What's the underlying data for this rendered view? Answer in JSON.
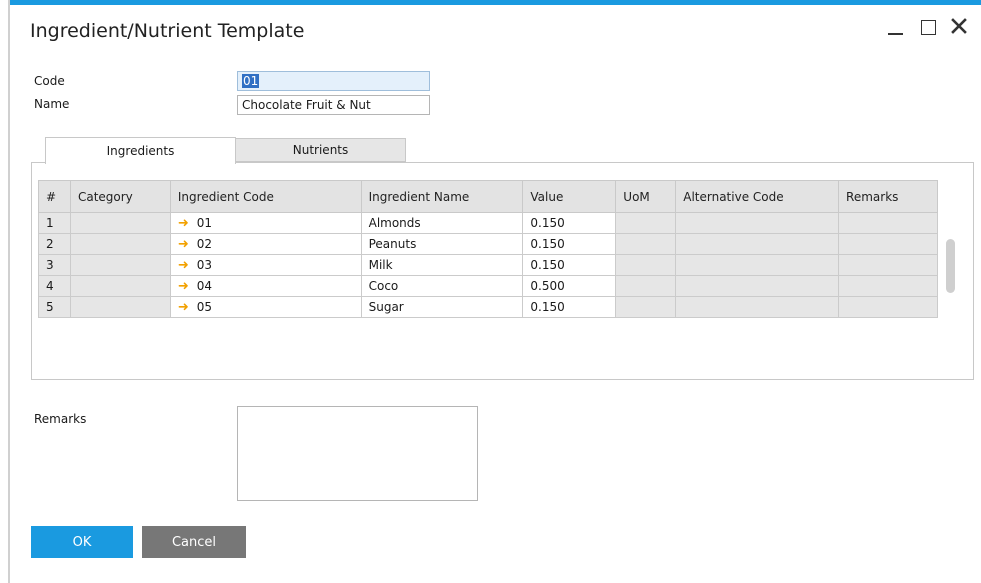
{
  "colors": {
    "accent": "#1a9ae0",
    "ok_button": "#1a9ae0",
    "cancel_button": "#777777",
    "arrow": "#f2a100"
  },
  "window": {
    "title": "Ingredient/Nutrient Template"
  },
  "form": {
    "code_label": "Code",
    "code_value": "01",
    "name_label": "Name",
    "name_value": "Chocolate Fruit & Nut"
  },
  "tabs": [
    {
      "label": "Ingredients",
      "active": true
    },
    {
      "label": "Nutrients",
      "active": false
    }
  ],
  "grid": {
    "columns": [
      "#",
      "Category",
      "Ingredient Code",
      "Ingredient Name",
      "Value",
      "UoM",
      "Alternative Code",
      "Remarks"
    ],
    "rows": [
      {
        "num": "1",
        "category": "",
        "code": "01",
        "name": "Almonds",
        "value": "0.150",
        "uom": "",
        "alt_code": "",
        "remarks": ""
      },
      {
        "num": "2",
        "category": "",
        "code": "02",
        "name": "Peanuts",
        "value": "0.150",
        "uom": "",
        "alt_code": "",
        "remarks": ""
      },
      {
        "num": "3",
        "category": "",
        "code": "03",
        "name": "Milk",
        "value": "0.150",
        "uom": "",
        "alt_code": "",
        "remarks": ""
      },
      {
        "num": "4",
        "category": "",
        "code": "04",
        "name": "Coco",
        "value": "0.500",
        "uom": "",
        "alt_code": "",
        "remarks": ""
      },
      {
        "num": "5",
        "category": "",
        "code": "05",
        "name": "Sugar",
        "value": "0.150",
        "uom": "",
        "alt_code": "",
        "remarks": ""
      }
    ]
  },
  "remarks": {
    "label": "Remarks",
    "value": ""
  },
  "buttons": {
    "ok": "OK",
    "cancel": "Cancel"
  }
}
